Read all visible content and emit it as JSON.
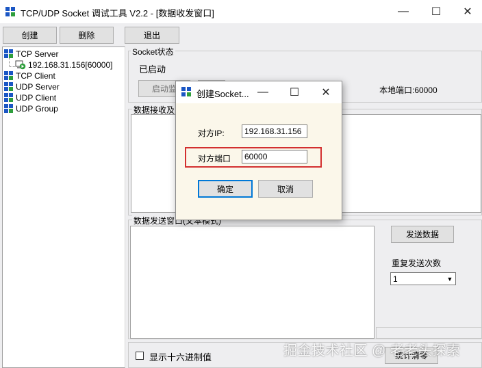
{
  "window": {
    "title": "TCP/UDP Socket 调试工具 V2.2 - [数据收发窗口]",
    "minimize": "—",
    "maximize": "☐",
    "close": "✕"
  },
  "toolbar": {
    "create_label": "创建",
    "delete_label": "删除",
    "exit_label": "退出"
  },
  "tree": {
    "items": [
      {
        "label": "TCP Server"
      },
      {
        "label": "192.168.31.156[60000]"
      },
      {
        "label": "TCP Client"
      },
      {
        "label": "UDP Server"
      },
      {
        "label": "UDP Client"
      },
      {
        "label": "UDP Group"
      }
    ]
  },
  "socket": {
    "group_label": "Socket状态",
    "status": "已启动",
    "start_button": "启动监",
    "local_port": "本地端口:60000"
  },
  "receive": {
    "group_label": "数据接收及"
  },
  "send": {
    "group_label": "数据发送窗口(文本模式)",
    "send_button": "发送数据",
    "repeat_label": "重复发送次数",
    "repeat_value": "1"
  },
  "footer": {
    "hex_label": "显示十六进制值",
    "stats_button": "统计清零"
  },
  "dialog": {
    "title": "创建Socket...",
    "minimize": "—",
    "maximize": "☐",
    "close": "✕",
    "ip_label": "对方IP:",
    "ip_value": "192.168.31.156",
    "port_label": "对方端口",
    "port_value": "60000",
    "ok_button": "确定",
    "cancel_button": "取消"
  },
  "watermark": "掘金技术社区 @ 老老头探索",
  "colors": {
    "highlight_border": "#d32f2f",
    "icon_blue": "#1a56c4",
    "icon_green": "#2e9e3c",
    "dialog_bg": "#fbf7ea"
  },
  "icons": [
    "app-icon",
    "dialog-icon",
    "server-node-icon",
    "socket-connection-icon",
    "checkbox-icon",
    "dropdown-arrow-icon"
  ]
}
